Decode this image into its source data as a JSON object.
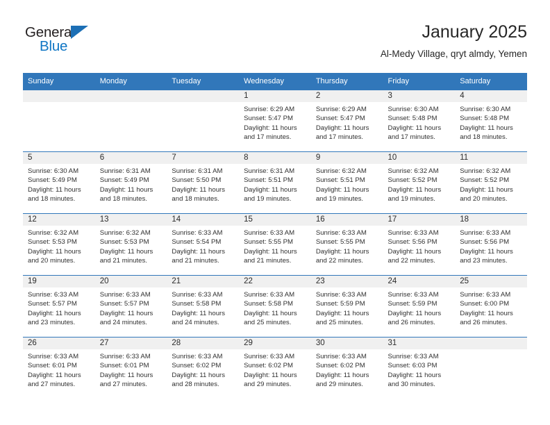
{
  "brand": {
    "name_top": "General",
    "name_bottom": "Blue",
    "color_blue": "#1076c4",
    "color_dark": "#231f20"
  },
  "header": {
    "title": "January 2025",
    "subtitle": "Al-Medy Village, qryt almdy, Yemen"
  },
  "theme": {
    "header_bg": "#3177ba",
    "header_text": "#ffffff",
    "daynum_band_bg": "#f0f0f0",
    "row_divider": "#3177ba"
  },
  "weekdays": [
    "Sunday",
    "Monday",
    "Tuesday",
    "Wednesday",
    "Thursday",
    "Friday",
    "Saturday"
  ],
  "weeks": [
    [
      {
        "day": "",
        "sunrise": "",
        "sunset": "",
        "daylight1": "",
        "daylight2": ""
      },
      {
        "day": "",
        "sunrise": "",
        "sunset": "",
        "daylight1": "",
        "daylight2": ""
      },
      {
        "day": "",
        "sunrise": "",
        "sunset": "",
        "daylight1": "",
        "daylight2": ""
      },
      {
        "day": "1",
        "sunrise": "Sunrise: 6:29 AM",
        "sunset": "Sunset: 5:47 PM",
        "daylight1": "Daylight: 11 hours",
        "daylight2": "and 17 minutes."
      },
      {
        "day": "2",
        "sunrise": "Sunrise: 6:29 AM",
        "sunset": "Sunset: 5:47 PM",
        "daylight1": "Daylight: 11 hours",
        "daylight2": "and 17 minutes."
      },
      {
        "day": "3",
        "sunrise": "Sunrise: 6:30 AM",
        "sunset": "Sunset: 5:48 PM",
        "daylight1": "Daylight: 11 hours",
        "daylight2": "and 17 minutes."
      },
      {
        "day": "4",
        "sunrise": "Sunrise: 6:30 AM",
        "sunset": "Sunset: 5:48 PM",
        "daylight1": "Daylight: 11 hours",
        "daylight2": "and 18 minutes."
      }
    ],
    [
      {
        "day": "5",
        "sunrise": "Sunrise: 6:30 AM",
        "sunset": "Sunset: 5:49 PM",
        "daylight1": "Daylight: 11 hours",
        "daylight2": "and 18 minutes."
      },
      {
        "day": "6",
        "sunrise": "Sunrise: 6:31 AM",
        "sunset": "Sunset: 5:49 PM",
        "daylight1": "Daylight: 11 hours",
        "daylight2": "and 18 minutes."
      },
      {
        "day": "7",
        "sunrise": "Sunrise: 6:31 AM",
        "sunset": "Sunset: 5:50 PM",
        "daylight1": "Daylight: 11 hours",
        "daylight2": "and 18 minutes."
      },
      {
        "day": "8",
        "sunrise": "Sunrise: 6:31 AM",
        "sunset": "Sunset: 5:51 PM",
        "daylight1": "Daylight: 11 hours",
        "daylight2": "and 19 minutes."
      },
      {
        "day": "9",
        "sunrise": "Sunrise: 6:32 AM",
        "sunset": "Sunset: 5:51 PM",
        "daylight1": "Daylight: 11 hours",
        "daylight2": "and 19 minutes."
      },
      {
        "day": "10",
        "sunrise": "Sunrise: 6:32 AM",
        "sunset": "Sunset: 5:52 PM",
        "daylight1": "Daylight: 11 hours",
        "daylight2": "and 19 minutes."
      },
      {
        "day": "11",
        "sunrise": "Sunrise: 6:32 AM",
        "sunset": "Sunset: 5:52 PM",
        "daylight1": "Daylight: 11 hours",
        "daylight2": "and 20 minutes."
      }
    ],
    [
      {
        "day": "12",
        "sunrise": "Sunrise: 6:32 AM",
        "sunset": "Sunset: 5:53 PM",
        "daylight1": "Daylight: 11 hours",
        "daylight2": "and 20 minutes."
      },
      {
        "day": "13",
        "sunrise": "Sunrise: 6:32 AM",
        "sunset": "Sunset: 5:53 PM",
        "daylight1": "Daylight: 11 hours",
        "daylight2": "and 21 minutes."
      },
      {
        "day": "14",
        "sunrise": "Sunrise: 6:33 AM",
        "sunset": "Sunset: 5:54 PM",
        "daylight1": "Daylight: 11 hours",
        "daylight2": "and 21 minutes."
      },
      {
        "day": "15",
        "sunrise": "Sunrise: 6:33 AM",
        "sunset": "Sunset: 5:55 PM",
        "daylight1": "Daylight: 11 hours",
        "daylight2": "and 21 minutes."
      },
      {
        "day": "16",
        "sunrise": "Sunrise: 6:33 AM",
        "sunset": "Sunset: 5:55 PM",
        "daylight1": "Daylight: 11 hours",
        "daylight2": "and 22 minutes."
      },
      {
        "day": "17",
        "sunrise": "Sunrise: 6:33 AM",
        "sunset": "Sunset: 5:56 PM",
        "daylight1": "Daylight: 11 hours",
        "daylight2": "and 22 minutes."
      },
      {
        "day": "18",
        "sunrise": "Sunrise: 6:33 AM",
        "sunset": "Sunset: 5:56 PM",
        "daylight1": "Daylight: 11 hours",
        "daylight2": "and 23 minutes."
      }
    ],
    [
      {
        "day": "19",
        "sunrise": "Sunrise: 6:33 AM",
        "sunset": "Sunset: 5:57 PM",
        "daylight1": "Daylight: 11 hours",
        "daylight2": "and 23 minutes."
      },
      {
        "day": "20",
        "sunrise": "Sunrise: 6:33 AM",
        "sunset": "Sunset: 5:57 PM",
        "daylight1": "Daylight: 11 hours",
        "daylight2": "and 24 minutes."
      },
      {
        "day": "21",
        "sunrise": "Sunrise: 6:33 AM",
        "sunset": "Sunset: 5:58 PM",
        "daylight1": "Daylight: 11 hours",
        "daylight2": "and 24 minutes."
      },
      {
        "day": "22",
        "sunrise": "Sunrise: 6:33 AM",
        "sunset": "Sunset: 5:58 PM",
        "daylight1": "Daylight: 11 hours",
        "daylight2": "and 25 minutes."
      },
      {
        "day": "23",
        "sunrise": "Sunrise: 6:33 AM",
        "sunset": "Sunset: 5:59 PM",
        "daylight1": "Daylight: 11 hours",
        "daylight2": "and 25 minutes."
      },
      {
        "day": "24",
        "sunrise": "Sunrise: 6:33 AM",
        "sunset": "Sunset: 5:59 PM",
        "daylight1": "Daylight: 11 hours",
        "daylight2": "and 26 minutes."
      },
      {
        "day": "25",
        "sunrise": "Sunrise: 6:33 AM",
        "sunset": "Sunset: 6:00 PM",
        "daylight1": "Daylight: 11 hours",
        "daylight2": "and 26 minutes."
      }
    ],
    [
      {
        "day": "26",
        "sunrise": "Sunrise: 6:33 AM",
        "sunset": "Sunset: 6:01 PM",
        "daylight1": "Daylight: 11 hours",
        "daylight2": "and 27 minutes."
      },
      {
        "day": "27",
        "sunrise": "Sunrise: 6:33 AM",
        "sunset": "Sunset: 6:01 PM",
        "daylight1": "Daylight: 11 hours",
        "daylight2": "and 27 minutes."
      },
      {
        "day": "28",
        "sunrise": "Sunrise: 6:33 AM",
        "sunset": "Sunset: 6:02 PM",
        "daylight1": "Daylight: 11 hours",
        "daylight2": "and 28 minutes."
      },
      {
        "day": "29",
        "sunrise": "Sunrise: 6:33 AM",
        "sunset": "Sunset: 6:02 PM",
        "daylight1": "Daylight: 11 hours",
        "daylight2": "and 29 minutes."
      },
      {
        "day": "30",
        "sunrise": "Sunrise: 6:33 AM",
        "sunset": "Sunset: 6:02 PM",
        "daylight1": "Daylight: 11 hours",
        "daylight2": "and 29 minutes."
      },
      {
        "day": "31",
        "sunrise": "Sunrise: 6:33 AM",
        "sunset": "Sunset: 6:03 PM",
        "daylight1": "Daylight: 11 hours",
        "daylight2": "and 30 minutes."
      },
      {
        "day": "",
        "sunrise": "",
        "sunset": "",
        "daylight1": "",
        "daylight2": ""
      }
    ]
  ]
}
